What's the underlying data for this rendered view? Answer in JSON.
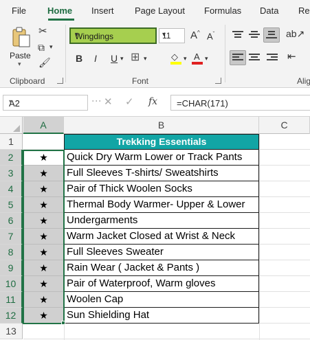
{
  "ribbon_tabs": [
    "File",
    "Home",
    "Insert",
    "Page Layout",
    "Formulas",
    "Data",
    "Re"
  ],
  "clipboard": {
    "paste_label": "Paste",
    "group_label": "Clipboard"
  },
  "font": {
    "name": "Wingdings",
    "size": "11",
    "group_label": "Font",
    "bold": "B",
    "italic": "I",
    "underline": "U"
  },
  "alignment": {
    "group_label": "Alig"
  },
  "formula_bar": {
    "name_box": "A2",
    "formula": "=CHAR(171)"
  },
  "columns": [
    "A",
    "B",
    "C"
  ],
  "rows": [
    "1",
    "2",
    "3",
    "4",
    "5",
    "6",
    "7",
    "8",
    "9",
    "10",
    "11",
    "12",
    "13"
  ],
  "table": {
    "header": "Trekking Essentials",
    "symbol": "★",
    "items": [
      "Quick Dry Warm Lower or Track Pants",
      "Full Sleeves T-shirts/ Sweatshirts",
      "Pair of Thick Woolen Socks",
      "Thermal Body Warmer- Upper & Lower",
      "Undergarments",
      "Warm Jacket Closed at Wrist & Neck",
      "Full Sleeves Sweater",
      "Rain Wear ( Jacket & Pants )",
      "Pair of Waterproof, Warm gloves",
      "Woolen Cap",
      "Sun Shielding Hat"
    ]
  },
  "colors": {
    "accent": "#217346",
    "header_fill": "#12a5a5",
    "font_box_fill": "#a6cf4f"
  }
}
